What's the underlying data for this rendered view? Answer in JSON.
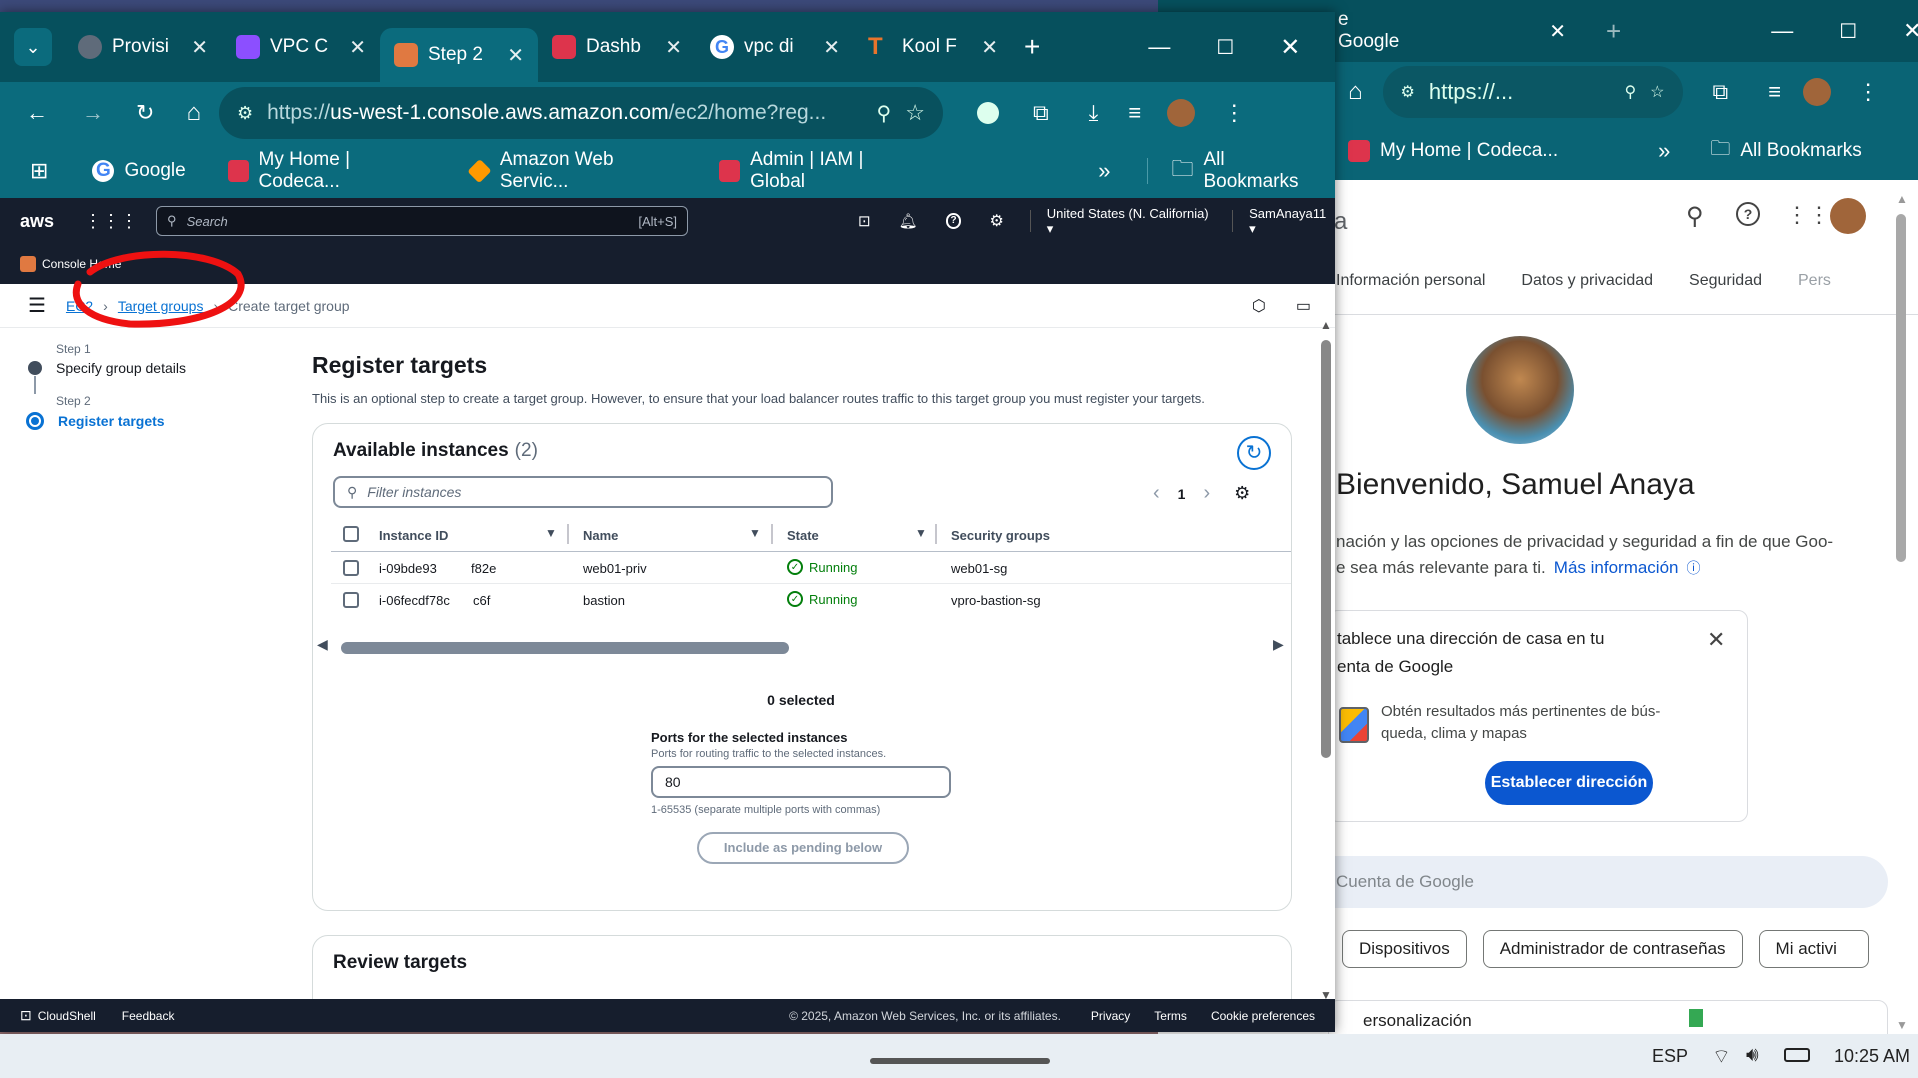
{
  "google_window": {
    "tab_title": "e Google",
    "url": "https://...",
    "bookmarks": {
      "home": "My Home | Codeca...",
      "overflow": "»",
      "all": "All Bookmarks"
    },
    "tabs": [
      "Información personal",
      "Datos y privacidad",
      "Seguridad",
      "Pers"
    ],
    "welcome": "Bienvenido, Samuel Anaya",
    "intro": "nación y las opciones de privacidad y seguridad a fin de que Goo-",
    "intro2": "e sea más relevante para ti.",
    "more_info": "Más información",
    "promo_title": "tablece una dirección de casa en tu",
    "promo_title2": "enta de Google",
    "promo_body": "Obtén resultados más pertinentes de bús-",
    "promo_body2": "queda, clima y mapas",
    "promo_button": "Establecer dirección",
    "search_placeholder": "Cuenta de Google",
    "chips": [
      "Dispositivos",
      "Administrador de contraseñas",
      "Mi activi"
    ],
    "bottom_text": "ersonalización",
    "header_letter": "a"
  },
  "browser": {
    "tabs": [
      {
        "label": "Provisi",
        "color": "#5f6b7a"
      },
      {
        "label": "VPC C",
        "color": "#8c4fff"
      },
      {
        "label": "Step 2",
        "color": "#e07941"
      },
      {
        "label": "Dashb",
        "color": "#dd344c"
      },
      {
        "label": "vpc di",
        "color": "#4285f4"
      },
      {
        "label": "Kool F",
        "color": "#e8742c"
      }
    ],
    "new_tab": "+",
    "url_prefix": "https://",
    "url_host": "us-west-1.console.aws.amazon.com",
    "url_path": "/ec2/home?reg...",
    "bookmarks": [
      "Google",
      "My Home | Codeca...",
      "Amazon Web Servic...",
      "Admin | IAM | Global"
    ],
    "bookmarks_overflow": "»",
    "all_bookmarks": "All Bookmarks"
  },
  "aws": {
    "logo": "aws",
    "search_placeholder": "Search",
    "search_shortcut": "[Alt+S]",
    "region": "United States (N. California)",
    "user": "SamAnaya11",
    "console_home": "Console Home",
    "breadcrumbs": [
      "EC2",
      "Target groups",
      "Create target group"
    ],
    "steps": [
      {
        "step": "Step 1",
        "label": "Specify group details"
      },
      {
        "step": "Step 2",
        "label": "Register targets"
      }
    ],
    "page_title": "Register targets",
    "description": "This is an optional step to create a target group. However, to ensure that your load balancer routes traffic to this target group you must register your targets.",
    "instances_title": "Available instances",
    "instances_count": "(2)",
    "filter_placeholder": "Filter instances",
    "page_number": "1",
    "columns": [
      "Instance ID",
      "Name",
      "State",
      "Security groups"
    ],
    "rows": [
      {
        "id": "i-09bde93",
        "id_tail": "f82e",
        "name": "web01-priv",
        "state": "Running",
        "sg": "web01-sg"
      },
      {
        "id": "i-06fecdf78c",
        "id_tail": "c6f",
        "name": "bastion",
        "state": "Running",
        "sg": "vpro-bastion-sg"
      }
    ],
    "selected": "0 selected",
    "ports_label": "Ports for the selected instances",
    "ports_hint": "Ports for routing traffic to the selected instances.",
    "ports_value": "80",
    "ports_range": "1-65535 (separate multiple ports with commas)",
    "include_button": "Include as pending below",
    "review_title": "Review targets",
    "footer": {
      "cloudshell": "CloudShell",
      "feedback": "Feedback",
      "copyright": "© 2025, Amazon Web Services, Inc. or its affiliates.",
      "privacy": "Privacy",
      "terms": "Terms",
      "cookies": "Cookie preferences"
    }
  },
  "taskbar": {
    "lang": "ESP",
    "time": "10:25 AM"
  }
}
